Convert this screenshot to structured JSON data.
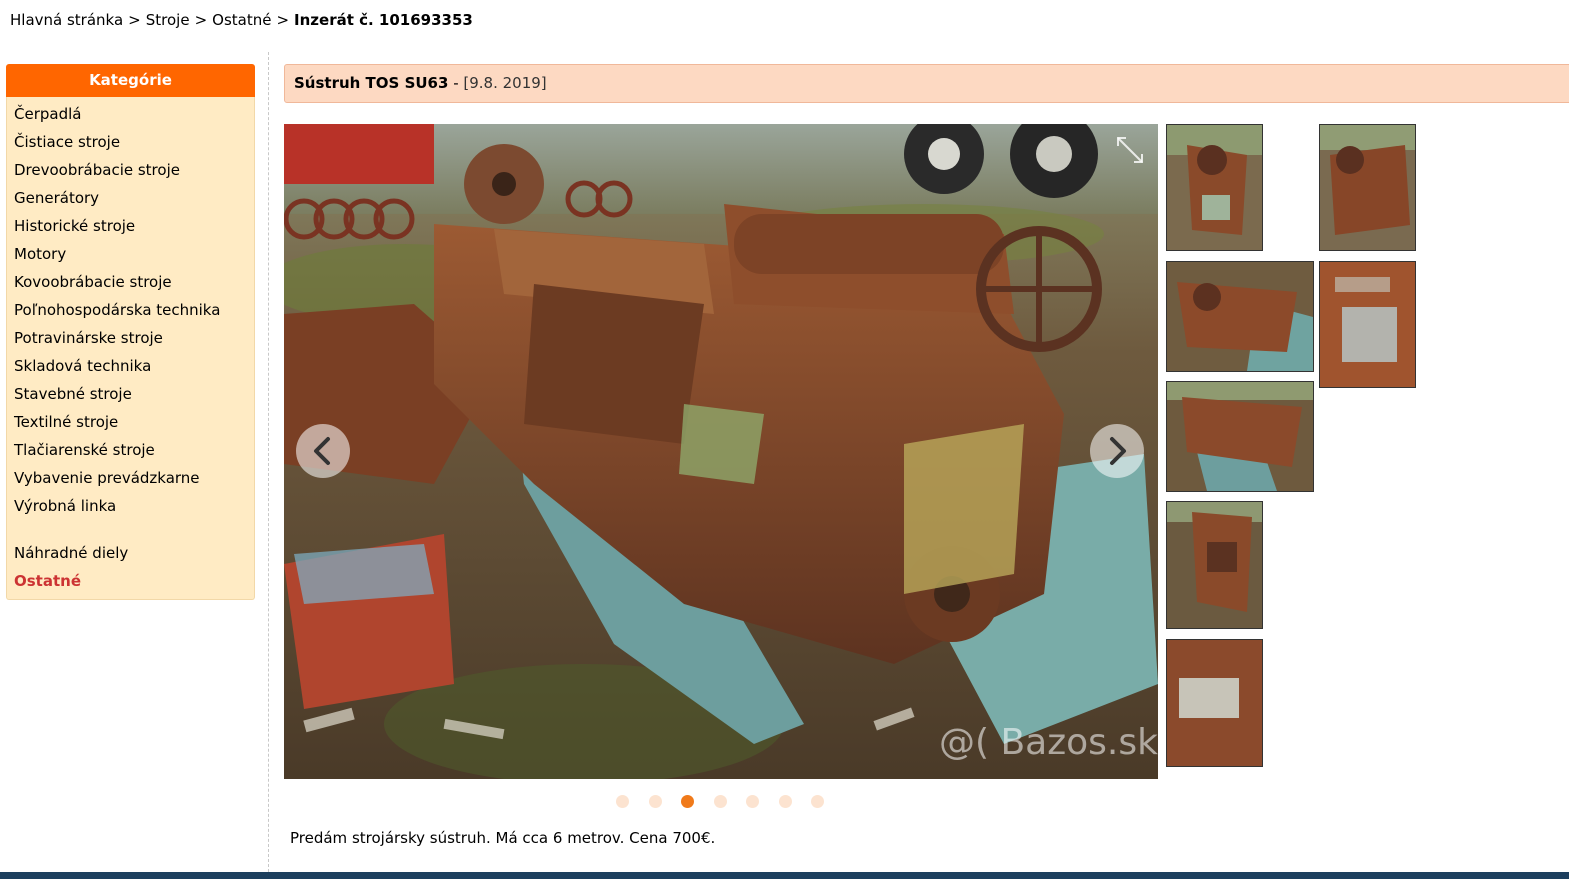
{
  "breadcrumb": {
    "home": "Hlavná stránka",
    "level1": "Stroje",
    "level2": "Ostatné",
    "current": "Inzerát č. 101693353",
    "separator": ">"
  },
  "sidebar": {
    "header": "Kategórie",
    "items": [
      "Čerpadlá",
      "Čistiace stroje",
      "Drevoobrábacie stroje",
      "Generátory",
      "Historické stroje",
      "Motory",
      "Kovoobrábacie stroje",
      "Poľnohospodárska technika",
      "Potravinárske stroje",
      "Skladová technika",
      "Stavebné stroje",
      "Textilné stroje",
      "Tlačiarenské stroje",
      "Vybavenie prevádzkarne",
      "Výrobná linka"
    ],
    "extra": [
      "Náhradné diely",
      "Ostatné"
    ],
    "active": "Ostatné"
  },
  "listing": {
    "title": "Sústruh TOS SU63",
    "date_sep": " - ",
    "date": "[9.8. 2019]",
    "description": "Predám strojársky sústruh. Má cca 6 metrov. Cena 700€."
  },
  "gallery": {
    "watermark": "@( Bazos.sk",
    "image_count": 7,
    "active_index": 2,
    "icons": {
      "prev": "chevron-left-icon",
      "next": "chevron-right-icon",
      "fullscreen": "expand-icon"
    }
  },
  "colors": {
    "accent": "#ff6600",
    "sidebar_bg": "#ffebc4",
    "title_bg": "#fdd9c2",
    "active_category": "#cc3333",
    "dot_active": "#f07a1a",
    "dot_inactive": "#fce3d0"
  }
}
